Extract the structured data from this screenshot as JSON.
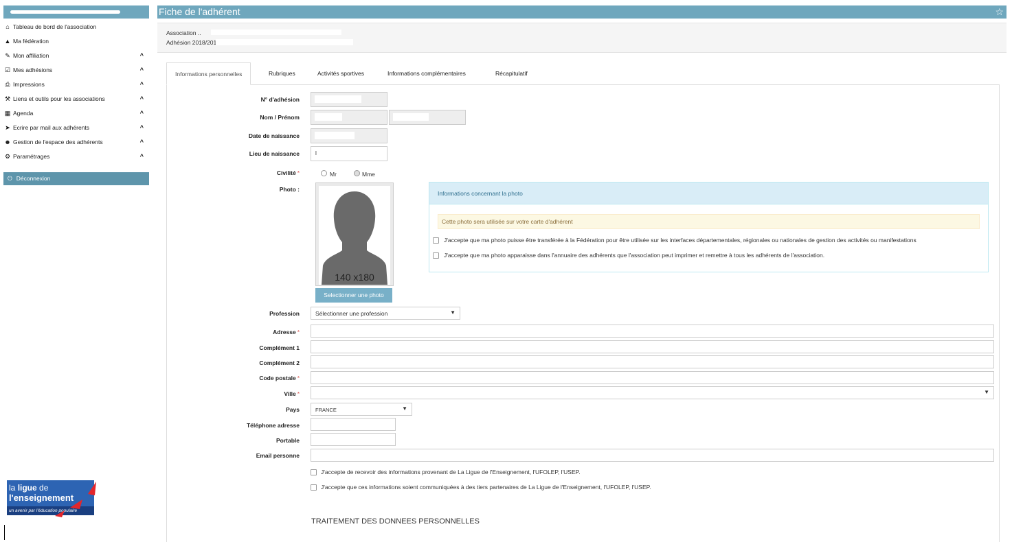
{
  "sidebar": {
    "menu": [
      {
        "label": "Tableau de bord de l'association",
        "icon": "home-icon",
        "glyph": "⌂",
        "chevron": false
      },
      {
        "label": "Ma fédération",
        "icon": "institution-icon",
        "glyph": "▲",
        "chevron": false
      },
      {
        "label": "Mon affiliation",
        "icon": "pencil-icon",
        "glyph": "✎",
        "chevron": true
      },
      {
        "label": "Mes adhésions",
        "icon": "edit-icon",
        "glyph": "☑",
        "chevron": true
      },
      {
        "label": "Impressions",
        "icon": "print-icon",
        "glyph": "⎙",
        "chevron": true
      },
      {
        "label": "Liens et outils pour les associations",
        "icon": "wrench-icon",
        "glyph": "⚒",
        "chevron": true
      },
      {
        "label": "Agenda",
        "icon": "calendar-icon",
        "glyph": "▦",
        "chevron": true
      },
      {
        "label": "Ecrire par mail aux adhérents",
        "icon": "send-icon",
        "glyph": "➤",
        "chevron": true
      },
      {
        "label": "Gestion de l'espace des adhérents",
        "icon": "user-icon",
        "glyph": "☻",
        "chevron": true
      },
      {
        "label": "Paramétrages",
        "icon": "gear-icon",
        "glyph": "⚙",
        "chevron": true
      }
    ],
    "chevron_glyph": "^",
    "logout": {
      "label": "Déconnexion",
      "glyph": "⏻"
    },
    "logo": {
      "line1_a": "la ",
      "line1_b": "ligue",
      "line1_c": " de",
      "line2": "l'enseignement",
      "tagline": "un avenir par l'éducation populaire"
    }
  },
  "header": {
    "title": "Fiche de l'adhérent",
    "star_glyph": "☆"
  },
  "assoc": {
    "line1": "Association ..",
    "line2": "Adhésion 2018/2019: N°."
  },
  "tabs": [
    "Informations personnelles",
    "Rubriques",
    "Activités sportives",
    "Informations complémentaires",
    "Récapitulatif"
  ],
  "form": {
    "numero_label": "N° d'adhésion",
    "nom_label": "Nom / Prénom",
    "naissance_label": "Date de naissance",
    "lieu_label": "Lieu de naissance",
    "lieu_value": "l",
    "civilite_label": "Civilité",
    "civilite_options": [
      "Mr",
      "Mme"
    ],
    "photo_label": "Photo :",
    "photo_placeholder": "140 x180",
    "photo_button": "Selectionner une photo",
    "required_mark": "*",
    "profession_label": "Profession",
    "profession_value": "Sélectionner une profession",
    "adresse_label": "Adresse",
    "complement1_label": "Complément 1",
    "complement2_label": "Complément 2",
    "code_postal_label": "Code postale",
    "ville_label": "Ville",
    "pays_label": "Pays",
    "pays_value": "FRANCE",
    "telephone_label": "Téléphone adresse",
    "portable_label": "Portable",
    "email_label": "Email personne",
    "consent1": "J'accepte de recevoir des informations provenant de La Ligue de l'Enseignement, l'UFOLEP, l'USEP.",
    "consent2": "J'accepte que ces informations soient communiquées à des tiers partenaires de La Ligue de l'Enseignement, l'UFOLEP, l'USEP.",
    "section_title": "TRAITEMENT DES DONNEES PERSONNELLES",
    "select_arrow": "▼"
  },
  "photo_info": {
    "title": "Informations concernant la photo",
    "warning": "Cette photo sera utilisée sur votre carte d'adhérent",
    "check1": "J'accepte que ma photo puisse être transférée à la Fédération pour être utilisée sur les interfaces départementales, régionales ou nationales de gestion des activités ou manifestations",
    "check2": "J'accepte que ma photo apparaisse dans l'annuaire des adhérents que l'association peut imprimer et remettre à tous les adhérents de l'association."
  }
}
